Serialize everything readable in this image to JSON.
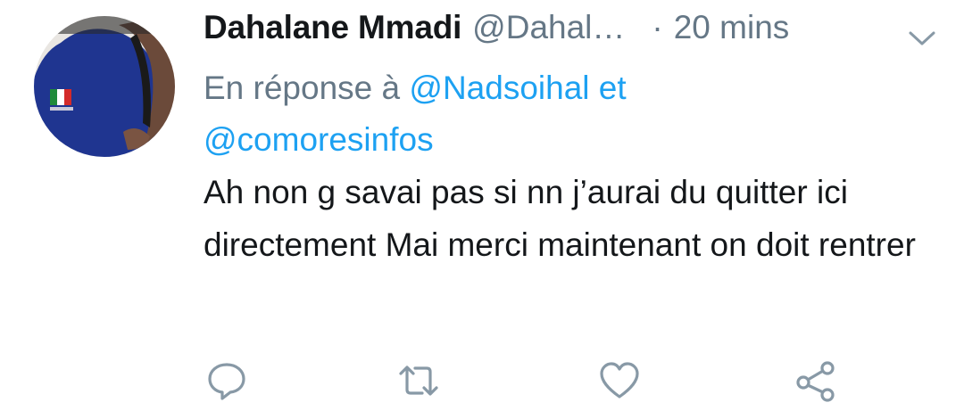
{
  "tweet": {
    "author_name": "Dahalane Mmadi",
    "author_handle": "@Dahal…",
    "separator": "·",
    "time": "20 mins",
    "reply_prefix": "En réponse à",
    "reply_mention_1": "@Nadsoihal",
    "reply_conjunction": "et",
    "reply_mention_2": "@comoresinfos",
    "text": "Ah non g savai pas si nn j’aurai du quitter ici directement Mai merci maintenant on doit rentrer"
  },
  "colors": {
    "accent": "#1da1f2",
    "secondary_text": "#657786",
    "primary_text": "#14171a",
    "icon": "#8899a6"
  },
  "icons": {
    "menu": "chevron-down-icon",
    "reply": "reply-icon",
    "retweet": "retweet-icon",
    "like": "heart-icon",
    "share": "share-icon"
  }
}
